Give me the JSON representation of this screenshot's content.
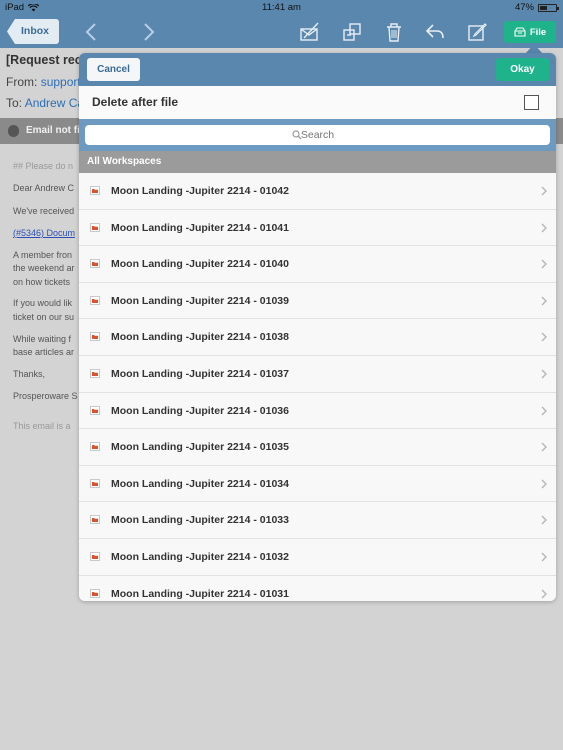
{
  "status_bar": {
    "device": "iPad",
    "time": "11:41 am",
    "battery": "47%",
    "battery_level": 0.47
  },
  "toolbar": {
    "back_label": "Inbox",
    "file_label": "File"
  },
  "email": {
    "subject": "[Request rec",
    "from_label": "From:",
    "from_value": "support",
    "to_label": "To:",
    "to_value": "Andrew Ca",
    "banner": "Email not fil",
    "body": [
      {
        "text": "## Please do n",
        "style": "muted"
      },
      {
        "text": "Dear Andrew C",
        "style": "normal"
      },
      {
        "text": "We've received",
        "style": "normal"
      },
      {
        "text": "(#5346) Docum",
        "style": "link"
      },
      {
        "text": "A member fron",
        "style": "normal"
      },
      {
        "text": "the weekend ar",
        "style": "normal"
      },
      {
        "text": "on how tickets",
        "style": "normal"
      },
      {
        "text": "If you would lik",
        "style": "normal"
      },
      {
        "text": "ticket on our su",
        "style": "normal"
      },
      {
        "text": "While waiting f",
        "style": "normal"
      },
      {
        "text": "base articles ar",
        "style": "normal"
      },
      {
        "text": "Thanks,",
        "style": "normal"
      },
      {
        "text": "Prosperoware S",
        "style": "normal"
      },
      {
        "text": "This email is a",
        "style": "muted"
      }
    ]
  },
  "popover": {
    "cancel_label": "Cancel",
    "okay_label": "Okay",
    "delete_label": "Delete after file",
    "delete_checked": false,
    "search_placeholder": "Search",
    "section_title": "All Workspaces",
    "workspaces": [
      "Moon Landing -Jupiter 2214 - 01042",
      "Moon Landing -Jupiter 2214 - 01041",
      "Moon Landing -Jupiter 2214 - 01040",
      "Moon Landing -Jupiter 2214 - 01039",
      "Moon Landing -Jupiter 2214 - 01038",
      "Moon Landing -Jupiter 2214 - 01037",
      "Moon Landing -Jupiter 2214 - 01036",
      "Moon Landing -Jupiter 2214 - 01035",
      "Moon Landing -Jupiter 2214 - 01034",
      "Moon Landing -Jupiter 2214 - 01033",
      "Moon Landing -Jupiter 2214 - 01032",
      "Moon Landing -Jupiter 2214 - 01031"
    ]
  },
  "colors": {
    "toolbar": "#5a87ad",
    "accent_green": "#1eb38a",
    "link": "#2c6fb6",
    "folder_icon": "#d9532c"
  }
}
